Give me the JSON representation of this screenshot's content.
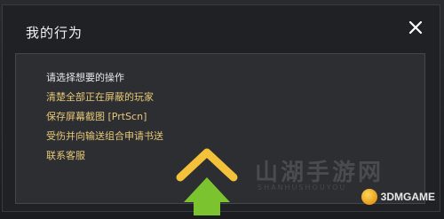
{
  "dialog": {
    "title": "我的行为",
    "close_icon": "close-icon"
  },
  "menu": {
    "prompt": "请选择想要的操作",
    "items": [
      "清楚全部正在屏蔽的玩家",
      "保存屏幕截图 [PrtScn]",
      "受伤并向输送组合申请书送",
      "联系客服"
    ]
  },
  "colors": {
    "dialog_bg": "#202124",
    "panel_bg": "#2d2e31",
    "menu_text": "#e6c878",
    "arrow_gold": "#f3c13a",
    "arrow_green": "#7cc42f"
  },
  "watermark": {
    "text": "山湖手游网",
    "sub": "SHANHUSHOUYOU"
  },
  "brand": {
    "name": "3DMGAME"
  }
}
